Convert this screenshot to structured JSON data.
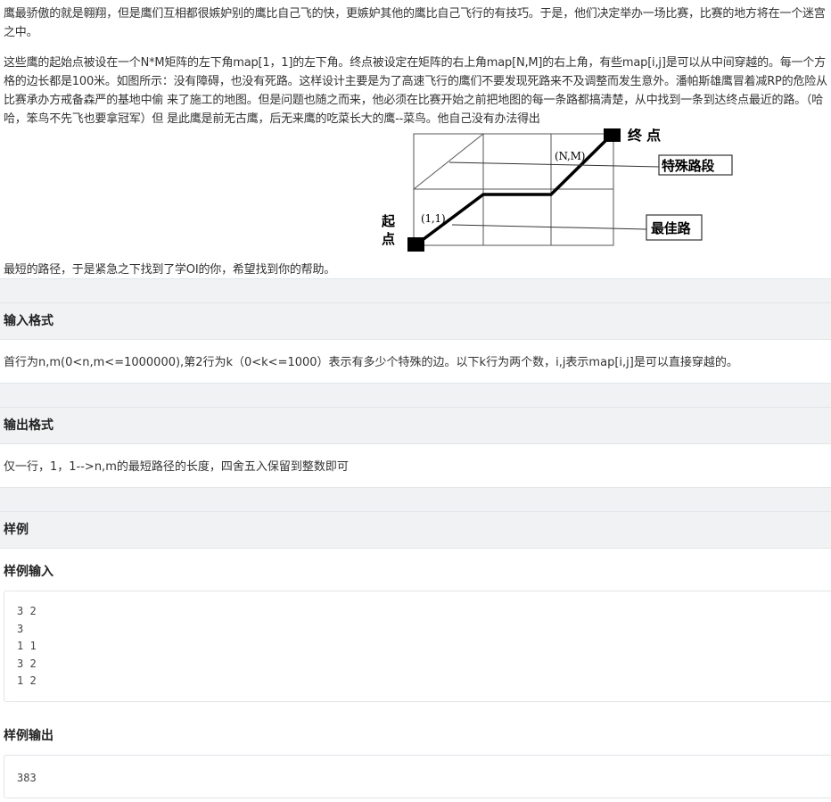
{
  "description": {
    "para1": "鹰最骄傲的就是翱翔，但是鹰们互相都很嫉妒别的鹰比自己飞的快，更嫉妒其他的鹰比自己飞行的有技巧。于是，他们决定举办一场比赛，比赛的地方将在一个迷宫之中。",
    "para2": "这些鹰的起始点被设在一个N*M矩阵的左下角map[1，1]的左下角。终点被设定在矩阵的右上角map[N,M]的右上角，有些map[i,j]是可以从中间穿越的。每一个方格的边长都是100米。如图所示：没有障碍，也没有死路。这样设计主要是为了高速飞行的鹰们不要发现死路来不及调整而发生意外。潘帕斯雄鹰冒着减RP的危险从比赛承办方戒备森严的基地中偷 来了施工的地图。但是问题也随之而来，他必须在比赛开始之前把地图的每一条路都搞清楚，从中找到一条到达终点最近的路。（哈哈，笨鸟不先飞也要拿冠军）但 是此鹰是前无古鹰，后无来鹰的吃菜长大的鹰--菜鸟。他自己没有办法得出",
    "para2_tail": "最短的路径，于是紧急之下找到了学OI的你，希望找到你的帮助。"
  },
  "figure": {
    "end_label": "终 点",
    "start_label_1": "起",
    "start_label_2": "点",
    "nm_label": "(N,M)",
    "one_one_label": "(1,1)",
    "special_label": "特殊路段",
    "best_label": "最佳路"
  },
  "input_format": {
    "title": "输入格式",
    "text": "首行为n,m(0<n,m<=1000000),第2行为k（0<k<=1000）表示有多少个特殊的边。以下k行为两个数，i,j表示map[i,j]是可以直接穿越的。"
  },
  "output_format": {
    "title": "输出格式",
    "text": "仅一行，1，1-->n,m的最短路径的长度，四舍五入保留到整数即可"
  },
  "samples": {
    "title": "样例",
    "input_title": "样例输入",
    "input_lines": "3 2\n3\n1 1\n3 2\n1 2",
    "output_title": "样例输出",
    "output_value": "383"
  }
}
